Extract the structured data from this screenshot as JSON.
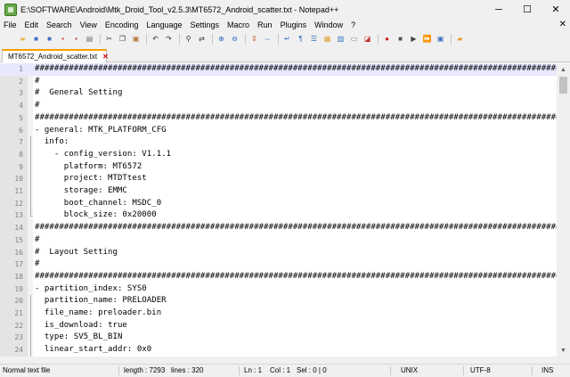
{
  "window": {
    "title": "E:\\SOFTWARE\\Android\\Mtk_Droid_Tool_v2.5.3\\MT6572_Android_scatter.txt - Notepad++",
    "controls": [
      "─",
      "☐",
      "✕"
    ]
  },
  "menu": [
    "File",
    "Edit",
    "Search",
    "View",
    "Encoding",
    "Language",
    "Settings",
    "Macro",
    "Run",
    "Plugins",
    "Window",
    "?"
  ],
  "menu_close": "✕",
  "toolbar": [
    {
      "name": "new-file-icon",
      "glyph": "▫",
      "color": "#ffffff"
    },
    {
      "name": "open-file-icon",
      "glyph": "▰",
      "color": "#e6b84a"
    },
    {
      "name": "save-icon",
      "glyph": "■",
      "color": "#3d6fc4"
    },
    {
      "name": "save-all-icon",
      "glyph": "■",
      "color": "#3d6fc4"
    },
    {
      "name": "close-icon",
      "glyph": "▪",
      "color": "#c04040"
    },
    {
      "name": "close-all-icon",
      "glyph": "▪",
      "color": "#c04040"
    },
    {
      "name": "print-icon",
      "glyph": "▤",
      "color": "#707070"
    },
    {
      "name": "sep"
    },
    {
      "name": "cut-icon",
      "glyph": "✂",
      "color": "#404040"
    },
    {
      "name": "copy-icon",
      "glyph": "❐",
      "color": "#404040"
    },
    {
      "name": "paste-icon",
      "glyph": "▣",
      "color": "#b07830"
    },
    {
      "name": "sep"
    },
    {
      "name": "undo-icon",
      "glyph": "↶",
      "color": "#303030"
    },
    {
      "name": "redo-icon",
      "glyph": "↷",
      "color": "#303030"
    },
    {
      "name": "sep"
    },
    {
      "name": "find-icon",
      "glyph": "⚲",
      "color": "#303030"
    },
    {
      "name": "replace-icon",
      "glyph": "⇄",
      "color": "#303030"
    },
    {
      "name": "sep"
    },
    {
      "name": "zoom-in-icon",
      "glyph": "⊕",
      "color": "#3070c0"
    },
    {
      "name": "zoom-out-icon",
      "glyph": "⊖",
      "color": "#3070c0"
    },
    {
      "name": "sep"
    },
    {
      "name": "sync-vertical-icon",
      "glyph": "⇕",
      "color": "#c06030"
    },
    {
      "name": "sync-horizontal-icon",
      "glyph": "⇔",
      "color": "#3070c0"
    },
    {
      "name": "sep"
    },
    {
      "name": "word-wrap-icon",
      "glyph": "↵",
      "color": "#3070c0"
    },
    {
      "name": "show-all-chars-icon",
      "glyph": "¶",
      "color": "#3070c0"
    },
    {
      "name": "indent-guide-icon",
      "glyph": "☰",
      "color": "#3070c0"
    },
    {
      "name": "doc-map-icon",
      "glyph": "▦",
      "color": "#e0a030"
    },
    {
      "name": "function-list-icon",
      "glyph": "▥",
      "color": "#3070c0"
    },
    {
      "name": "folder-workspace-icon",
      "glyph": "▭",
      "color": "#707070"
    },
    {
      "name": "monitor-icon",
      "glyph": "◪",
      "color": "#c03030"
    },
    {
      "name": "sep"
    },
    {
      "name": "record-macro-icon",
      "glyph": "●",
      "color": "#d02020"
    },
    {
      "name": "stop-record-icon",
      "glyph": "■",
      "color": "#505050"
    },
    {
      "name": "playback-macro-icon",
      "glyph": "▶",
      "color": "#404040"
    },
    {
      "name": "run-macro-multiple-icon",
      "glyph": "⏩",
      "color": "#404040"
    },
    {
      "name": "save-macro-icon",
      "glyph": "▣",
      "color": "#3d6fc4"
    },
    {
      "name": "sep"
    },
    {
      "name": "launch-icon",
      "glyph": "▰",
      "color": "#e0a030"
    }
  ],
  "tab": {
    "label": "MT6572_Android_scatter.txt",
    "close": "✕"
  },
  "editor": {
    "lines": [
      {
        "n": "1",
        "text": "############################################################################################################",
        "fold": "",
        "current": true
      },
      {
        "n": "2",
        "text": "#",
        "fold": ""
      },
      {
        "n": "3",
        "text": "#  General Setting",
        "fold": ""
      },
      {
        "n": "4",
        "text": "#",
        "fold": ""
      },
      {
        "n": "5",
        "text": "############################################################################################################",
        "fold": ""
      },
      {
        "n": "6",
        "text": "- general: MTK_PLATFORM_CFG",
        "fold": ""
      },
      {
        "n": "7",
        "text": "  info:",
        "fold": "v"
      },
      {
        "n": "8",
        "text": "    - config_version: V1.1.1",
        "fold": "v"
      },
      {
        "n": "9",
        "text": "      platform: MT6572",
        "fold": "v"
      },
      {
        "n": "10",
        "text": "      project: MTDTtest",
        "fold": "v"
      },
      {
        "n": "11",
        "text": "      storage: EMMC",
        "fold": "v"
      },
      {
        "n": "12",
        "text": "      boot_channel: MSDC_0",
        "fold": "v"
      },
      {
        "n": "13",
        "text": "      block_size: 0x20000",
        "fold": "end"
      },
      {
        "n": "14",
        "text": "############################################################################################################",
        "fold": ""
      },
      {
        "n": "15",
        "text": "#",
        "fold": ""
      },
      {
        "n": "16",
        "text": "#  Layout Setting",
        "fold": ""
      },
      {
        "n": "17",
        "text": "#",
        "fold": ""
      },
      {
        "n": "18",
        "text": "############################################################################################################",
        "fold": ""
      },
      {
        "n": "19",
        "text": "- partition_index: SYS0",
        "fold": ""
      },
      {
        "n": "20",
        "text": "  partition_name: PRELOADER",
        "fold": "v"
      },
      {
        "n": "21",
        "text": "  file_name: preloader.bin",
        "fold": "v"
      },
      {
        "n": "22",
        "text": "  is_download: true",
        "fold": "v"
      },
      {
        "n": "23",
        "text": "  type: SV5_BL_BIN",
        "fold": "v"
      },
      {
        "n": "24",
        "text": "  linear_start_addr: 0x0",
        "fold": "v"
      }
    ]
  },
  "scrollbar": {
    "up": "▲",
    "down": "▼"
  },
  "status": {
    "file_type": "Normal text file",
    "length": "length : 7293",
    "lines": "lines : 320",
    "ln": "Ln : 1",
    "col": "Col : 1",
    "sel": "Sel : 0 | 0",
    "eol": "UNIX",
    "encoding": "UTF-8",
    "mode": "INS"
  }
}
